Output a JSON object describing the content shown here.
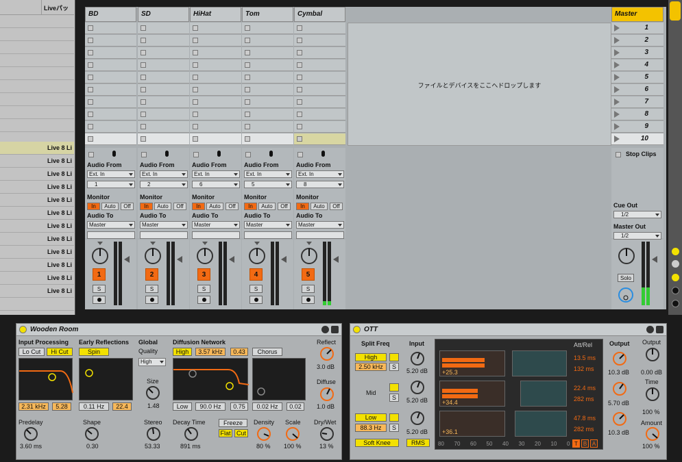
{
  "browser": {
    "header": "Liveパッ",
    "items": [
      "Live 8 Li",
      "Live 8 Li",
      "Live 8 Li",
      "Live 8 Li",
      "Live 8 Li",
      "Live 8 Li",
      "Live 8 Li",
      "Live 8 Li",
      "Live 8 Li",
      "Live 8 Li",
      "Live 8 Li",
      "Live 8 Li"
    ]
  },
  "tracks": [
    {
      "name": "BD",
      "input": "1",
      "num": "1"
    },
    {
      "name": "SD",
      "input": "2",
      "num": "2"
    },
    {
      "name": "HiHat",
      "input": "6",
      "num": "3"
    },
    {
      "name": "Tom",
      "input": "5",
      "num": "4"
    },
    {
      "name": "Cymbal",
      "input": "8",
      "num": "5"
    }
  ],
  "labels": {
    "audio_from": "Audio From",
    "ext_in": "Ext. In",
    "monitor": "Monitor",
    "mon_in": "In",
    "mon_auto": "Auto",
    "mon_off": "Off",
    "audio_to": "Audio To",
    "master_out": "Master",
    "solo_s": "S",
    "drop_text": "ファイルとデバイスをここへドロップします"
  },
  "master": {
    "name": "Master",
    "scenes": [
      "1",
      "2",
      "3",
      "4",
      "5",
      "6",
      "7",
      "8",
      "9",
      "10"
    ],
    "stop_clips": "Stop Clips",
    "cue_out_label": "Cue Out",
    "cue_out": "1/2",
    "master_out_label": "Master Out",
    "master_out": "1/2",
    "solo": "Solo"
  },
  "reverb": {
    "title": "Wooden Room",
    "input_processing": "Input Processing",
    "lo_cut": "Lo Cut",
    "hi_cut": "Hi Cut",
    "early_reflections": "Early Reflections",
    "spin": "Spin",
    "global": "Global",
    "quality": "Quality",
    "quality_val": "High",
    "diffusion_network": "Diffusion Network",
    "high": "High",
    "high_freq": "3.57 kHz",
    "high_amt": "0.43",
    "chorus": "Chorus",
    "reflect": "Reflect",
    "reflect_val": "3.0 dB",
    "diffuse": "Diffuse",
    "diffuse_val": "1.0 dB",
    "size": "Size",
    "size_val": "1.48",
    "in_freq": "2.31 kHz",
    "in_w": "5.28",
    "er_a": "0.11 Hz",
    "er_b": "22.4",
    "low": "Low",
    "low_freq": "90.0 Hz",
    "low_amt": "0.75",
    "ch_a": "0.02 Hz",
    "ch_b": "0.02",
    "predelay": "Predelay",
    "predelay_val": "3.60 ms",
    "shape": "Shape",
    "shape_val": "0.30",
    "stereo": "Stereo",
    "stereo_val": "53.33",
    "decay": "Decay Time",
    "decay_val": "891 ms",
    "freeze": "Freeze",
    "flat": "Flat",
    "cut": "Cut",
    "density": "Density",
    "density_val": "80 %",
    "scale": "Scale",
    "scale_val": "100 %",
    "drywet": "Dry/Wet",
    "drywet_val": "13 %"
  },
  "ott": {
    "title": "OTT",
    "split_freq": "Split Freq",
    "high": "High",
    "high_freq": "2.50 kHz",
    "mid": "Mid",
    "low": "Low",
    "low_freq": "88.3 Hz",
    "input": "Input",
    "in_h": "5.20 dB",
    "in_m": "5.20 dB",
    "in_l": "5.20 dB",
    "soft_knee": "Soft Knee",
    "rms": "RMS",
    "att_rel": "Att/Rel",
    "att_h": "13.5 ms",
    "rel_h": "132 ms",
    "att_m": "22.4 ms",
    "rel_m": "282 ms",
    "att_l": "47.8 ms",
    "rel_l": "282 ms",
    "gr_h": "+25.3",
    "gr_m": "+34.4",
    "gr_l": "+36.1",
    "scale": [
      "80",
      "70",
      "60",
      "50",
      "40",
      "30",
      "20",
      "10",
      "0"
    ],
    "tbr": [
      "T",
      "B",
      "A"
    ],
    "output": "Output",
    "out_h": "10.3 dB",
    "out_m": "5.70 dB",
    "out_l": "10.3 dB",
    "output2": "Output",
    "output2_val": "0.00 dB",
    "time": "Time",
    "time_val": "100 %",
    "amount": "Amount",
    "amount_val": "100 %",
    "solo": "S"
  },
  "colors": {
    "accent": "#f26a13",
    "yellow": "#f3e100",
    "master_header": "#f3c200"
  }
}
